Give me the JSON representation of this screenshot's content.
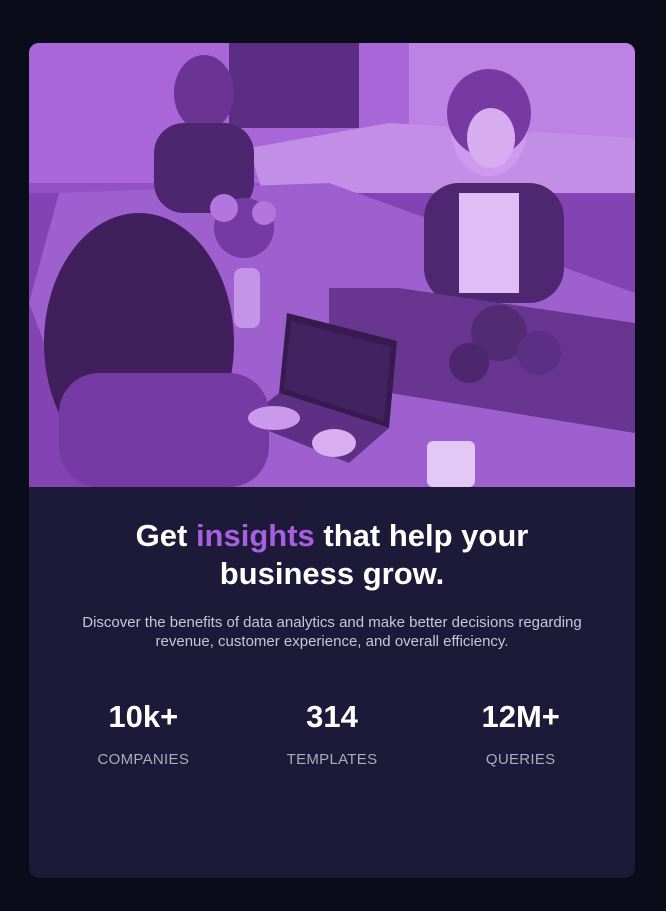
{
  "hero": {
    "image": "coworkers-working-at-office-table-with-laptop",
    "overlay_color": "#aa5cdb"
  },
  "headline": {
    "before": "Get ",
    "accent": "insights",
    "after": " that help your business grow."
  },
  "description": "Discover the benefits of data analytics and make better decisions regarding revenue, customer experience, and overall efficiency.",
  "stats": [
    {
      "value": "10k+",
      "label": "COMPANIES"
    },
    {
      "value": "314",
      "label": "TEMPLATES"
    },
    {
      "value": "12M+",
      "label": "QUERIES"
    }
  ],
  "colors": {
    "page_background": "#0a0c1a",
    "card_background": "#1c1a38",
    "accent": "#a960e0"
  }
}
